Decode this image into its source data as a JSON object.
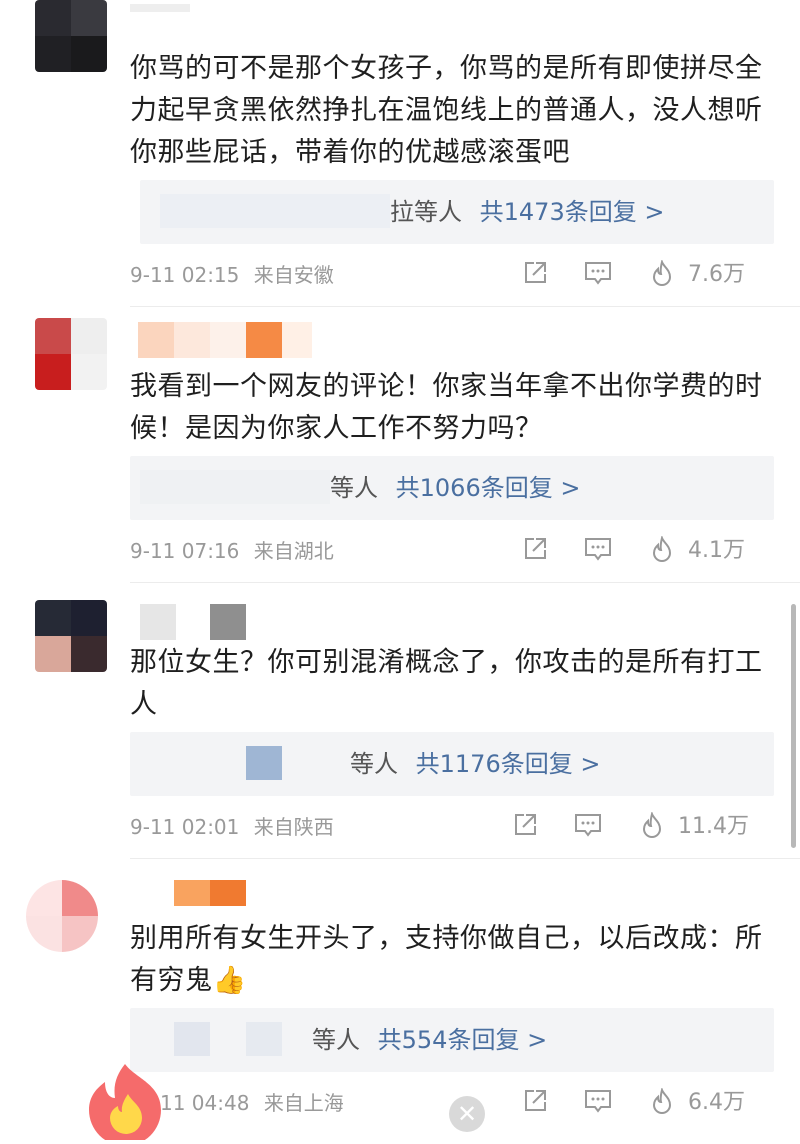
{
  "comments": [
    {
      "text": "你骂的可不是那个女孩子，你骂的是所有即使拼尽全力起早贪黑依然挣扎在温饱线上的普通人，没人想听你那些屁话，带着你的优越感滚蛋吧",
      "reply_who": "拉等人",
      "reply_count": "共1473条回复 >",
      "time": "9-11 02:15",
      "location": "来自安徽",
      "likes": "7.6万"
    },
    {
      "text": "我看到一个网友的评论！你家当年拿不出你学费的时候！是因为你家人工作不努力吗？",
      "reply_who": "等人",
      "reply_count": "共1066条回复 >",
      "time": "9-11 07:16",
      "location": "来自湖北",
      "likes": "4.1万"
    },
    {
      "text": "那位女生？你可别混淆概念了，你攻击的是所有打工人",
      "reply_who": "等人",
      "reply_count": "共1176条回复 >",
      "time": "9-11 02:01",
      "location": "来自陕西",
      "likes": "11.4万"
    },
    {
      "text": "别用所有女生开头了，支持你做自己，以后改成：所有穷鬼👍",
      "reply_who": "等人",
      "reply_count": "共554条回复 >",
      "time": "11 04:48",
      "location": "来自上海",
      "likes": "6.4万"
    }
  ],
  "icons": {
    "share": "share-icon",
    "comment": "comment-icon",
    "like": "flame-like-icon",
    "close": "close-icon"
  },
  "colors": {
    "reply_link": "#4a6fa0",
    "meta": "#999999",
    "reply_bg": "#f3f4f6"
  }
}
